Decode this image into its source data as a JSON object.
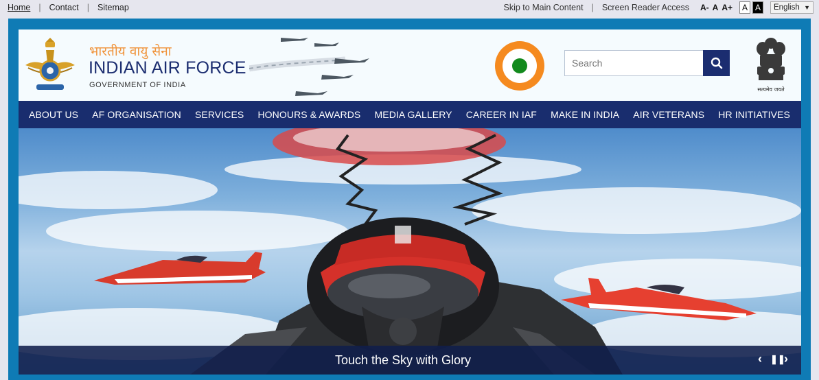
{
  "topbar": {
    "links": [
      "Home",
      "Contact",
      "Sitemap"
    ],
    "skip": "Skip to Main Content",
    "screen_reader": "Screen Reader Access",
    "font_small": "A-",
    "font_normal": "A",
    "font_large": "A+",
    "contrast_white": "A",
    "contrast_black": "A",
    "language": "English"
  },
  "header": {
    "hindi_title": "भारतीय वायु सेना",
    "title": "INDIAN AIR FORCE",
    "subtitle": "GOVERNMENT OF INDIA",
    "emblem_motto": "सत्यमेव जयते"
  },
  "search": {
    "placeholder": "Search"
  },
  "nav": [
    "ABOUT US",
    "AF ORGANISATION",
    "SERVICES",
    "HONOURS & AWARDS",
    "MEDIA GALLERY",
    "CAREER IN IAF",
    "MAKE IN INDIA",
    "AIR VETERANS",
    "HR INITIATIVES"
  ],
  "slider": {
    "caption": "Touch the Sky with Glory",
    "prev": "‹",
    "pause": "❚❚",
    "next": "›"
  },
  "colors": {
    "navy": "#1b2d70",
    "frame": "#0f7bb5",
    "saffron": "#f58a1f",
    "green": "#138a1d"
  }
}
